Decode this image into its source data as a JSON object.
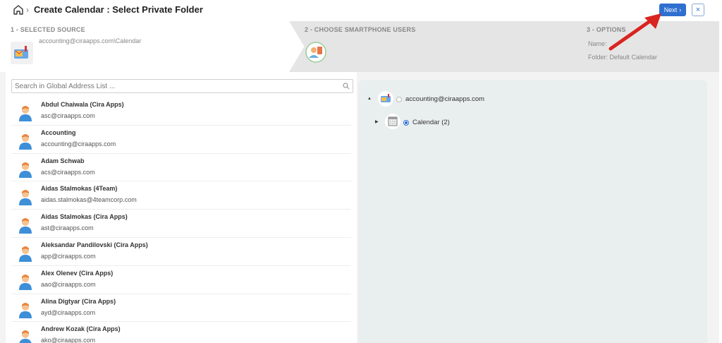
{
  "header": {
    "title": "Create Calendar  :  Select Private Folder",
    "next_label": "Next",
    "close_label": "×"
  },
  "steps": {
    "step1": {
      "title": "1 - SELECTED SOURCE",
      "source": "accounting@ciraapps.com\\Calendar"
    },
    "step2": {
      "title": "2 - CHOOSE SMARTPHONE USERS"
    },
    "step3": {
      "title": "3 - OPTIONS",
      "name_label": "Name:",
      "folder_label": "Folder: Default Calendar"
    }
  },
  "search": {
    "placeholder": "Search in Global Address List ..."
  },
  "contacts": [
    {
      "name": "Abdul Chaiwala (Cira Apps)",
      "email": "asc@ciraapps.com"
    },
    {
      "name": "Accounting",
      "email": "accounting@ciraapps.com"
    },
    {
      "name": "Adam Schwab",
      "email": "acs@ciraapps.com"
    },
    {
      "name": "Aidas Stalmokas (4Team)",
      "email": "aidas.stalmokas@4teamcorp.com"
    },
    {
      "name": "Aidas Stalmokas (Cira Apps)",
      "email": "ast@ciraapps.com"
    },
    {
      "name": "Aleksandar Pandilovski (Cira Apps)",
      "email": "app@ciraapps.com"
    },
    {
      "name": "Alex Olenev (Cira Apps)",
      "email": "aao@ciraapps.com"
    },
    {
      "name": "Alina Digtyar (Cira Apps)",
      "email": "ayd@ciraapps.com"
    },
    {
      "name": "Andrew Kozak (Cira Apps)",
      "email": "ako@ciraapps.com"
    }
  ],
  "tree": {
    "root": "accounting@ciraapps.com",
    "child": "Calendar (2)"
  },
  "colors": {
    "accent": "#2f6fd0",
    "arrow": "#d9241f"
  }
}
